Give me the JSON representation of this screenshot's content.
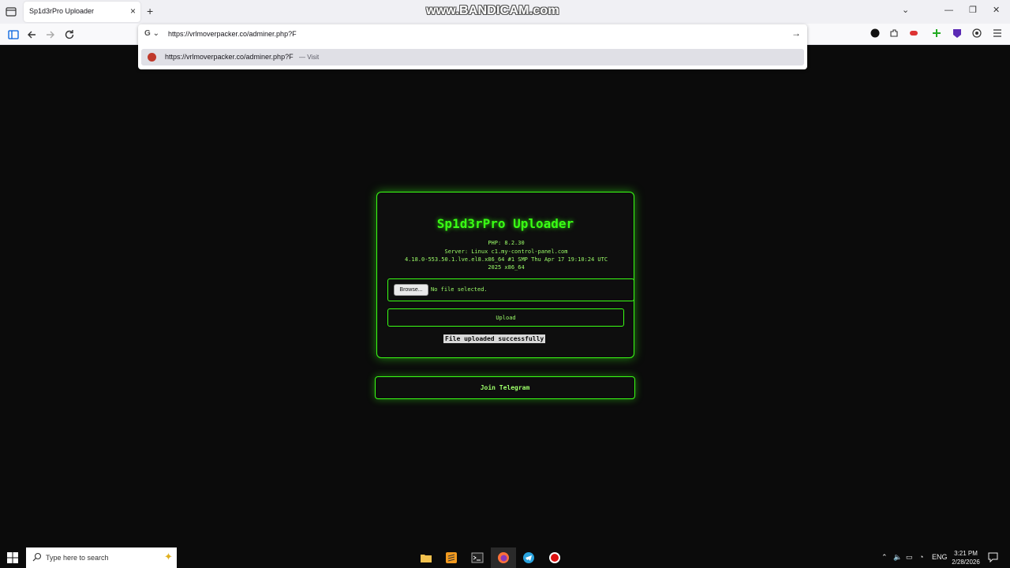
{
  "browser": {
    "tab_title": "Sp1d3rPro Uploader",
    "tab_close": "×",
    "new_tab": "+",
    "watermark": "www.BANDICAM.com",
    "engine_letter": "G",
    "url_value": "https://vrlmoverpacker.co/adminer.php?F",
    "suggestion_url": "https://vrlmoverpacker.co/adminer.php?F",
    "suggestion_action": "— Visit",
    "go_arrow": "→",
    "window_controls": [
      "⌄",
      "—",
      "❐",
      "✕"
    ]
  },
  "uploader": {
    "title": "Sp1d3rPro Uploader",
    "php": "PHP: 8.2.30",
    "server_lines": [
      "Server: Linux c1.my-control-panel.com",
      "4.18.0-553.50.1.lve.el8.x86_64 #1 SMP Thu Apr 17 19:10:24 UTC",
      "2025 x86_64"
    ],
    "browse_label": "Browse...",
    "no_file": "No file selected.",
    "upload_label": "Upload",
    "success_message": "File uploaded successfully",
    "telegram_label": "Join Telegram",
    "accent_color": "#39ff14"
  },
  "taskbar": {
    "search_placeholder": "Type here to search",
    "language": "ENG",
    "time": "3:21 PM",
    "date": "2/28/2026"
  }
}
